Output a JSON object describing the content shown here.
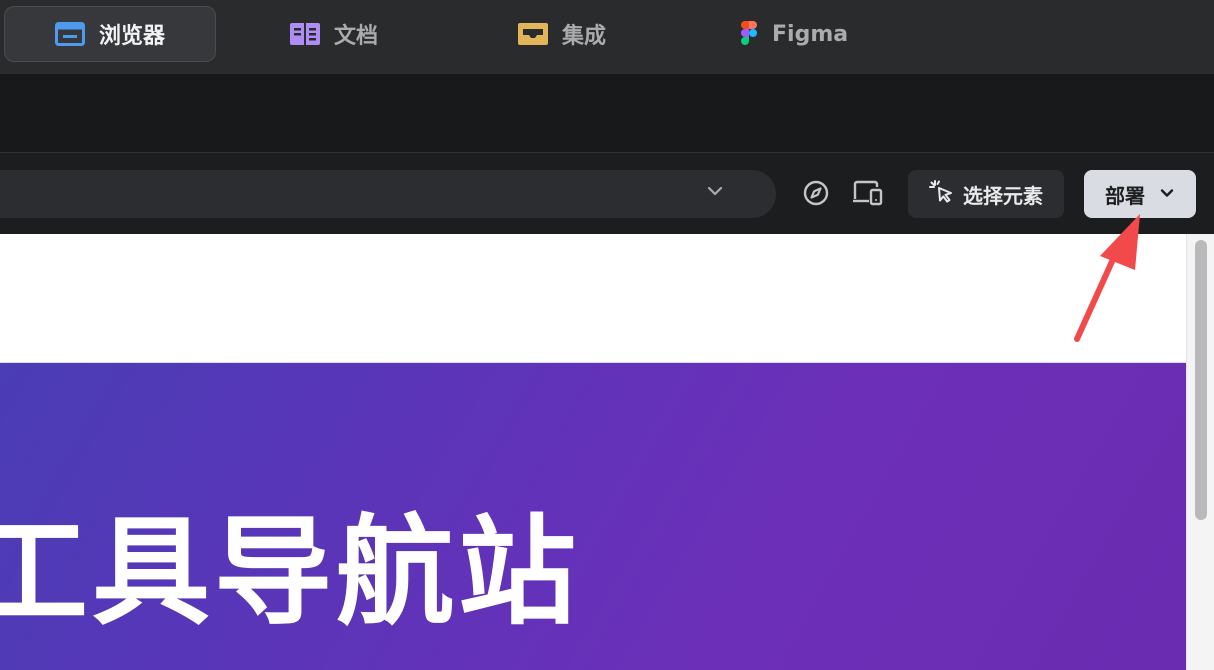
{
  "tabs": [
    {
      "label": "浏览器",
      "icon": "browser-window-icon",
      "active": true
    },
    {
      "label": "文档",
      "icon": "document-book-icon",
      "active": false
    },
    {
      "label": "集成",
      "icon": "integration-tray-icon",
      "active": false
    },
    {
      "label": "Figma",
      "icon": "figma-icon",
      "active": false
    }
  ],
  "toolbar": {
    "select_element_label": "选择元素",
    "deploy_label": "部署"
  },
  "page": {
    "hero_title": "工具导航站"
  },
  "colors": {
    "accent_blue": "#4e9af1",
    "accent_purple": "#b08cf5",
    "accent_gold": "#e3b55a",
    "annotation_red": "#f24a4a",
    "hero_gradient_start": "#4a3db5",
    "hero_gradient_end": "#6a2cb0"
  }
}
